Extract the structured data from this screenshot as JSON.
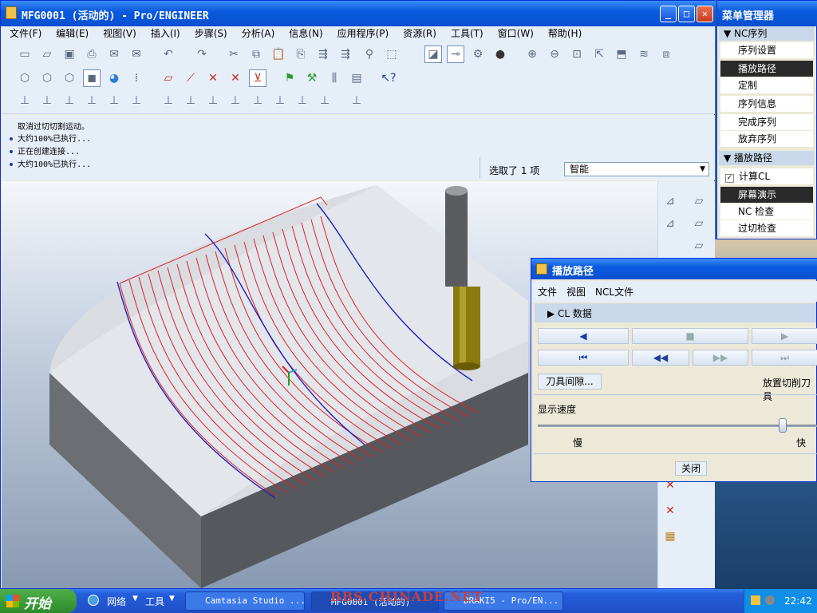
{
  "main_window": {
    "title": "MFG0001 (活动的) - Pro/ENGINEER",
    "menu": [
      "文件(F)",
      "编辑(E)",
      "视图(V)",
      "插入(I)",
      "步骤(S)",
      "分析(A)",
      "信息(N)",
      "应用程序(P)",
      "资源(R)",
      "工具(T)",
      "窗口(W)",
      "帮助(H)"
    ],
    "messages": [
      "取消过切切割运动。",
      "大约100%已执行...",
      "正在创建连接...",
      "大约100%已执行..."
    ],
    "selection_status": "选取了 1 项",
    "filter_value": "智能"
  },
  "menu_manager": {
    "title": "菜单管理器",
    "section1": "NC序列",
    "section1_items": [
      "序列设置",
      "播放路径",
      "定制",
      "序列信息",
      "完成序列",
      "放弃序列"
    ],
    "section2": "播放路径",
    "section2_items": [
      "计算CL",
      "屏幕演示",
      "NC 检查",
      "过切检查"
    ]
  },
  "playback": {
    "title": "播放路径",
    "menu": [
      "文件",
      "视图",
      "NCL文件"
    ],
    "cl_label": "CL 数据",
    "tool_clearance_button": "刀具间隙...",
    "place_tool_label": "放置切削刀具",
    "speed_label": "显示速度",
    "slow_label": "慢",
    "fast_label": "快",
    "speed_level": 0.9,
    "close_button": "关闭"
  },
  "taskbar": {
    "start": "开始",
    "quick": [
      "网络",
      "工具"
    ],
    "tasks": [
      "Camtasia Studio ...",
      "MFG0001 (活动的)",
      "DRAKI5 - Pro/EN..."
    ],
    "time": "22:42",
    "watermark": "BBS.CHINADE.NET"
  },
  "colors": {
    "titlebar": "#0b5bdf",
    "toolpath": "#e02020",
    "selected": "#2a2a2a"
  }
}
